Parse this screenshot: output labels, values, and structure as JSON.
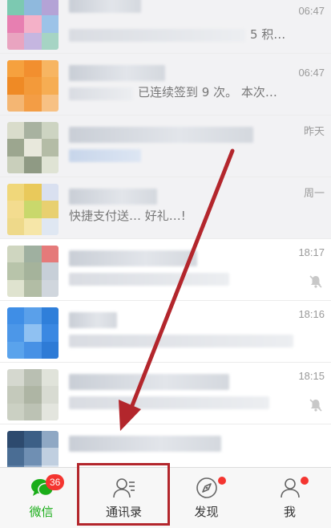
{
  "chats": [
    {
      "time": "06:47",
      "message": "5 积…"
    },
    {
      "time": "06:47",
      "message": "已连续签到 9 次。 本次…"
    },
    {
      "time": "昨天",
      "message": ""
    },
    {
      "time": "周一",
      "message": "快捷支付送… 好礼…!"
    },
    {
      "time": "18:17",
      "message": ""
    },
    {
      "time": "18:16",
      "message": ""
    },
    {
      "time": "18:15",
      "message": ""
    },
    {
      "time": "",
      "message": ""
    }
  ],
  "tabs": [
    {
      "label": "微信",
      "badge": "36",
      "icon": "chat-bubble-icon",
      "active": true
    },
    {
      "label": "通讯录",
      "icon": "contacts-icon",
      "active": false
    },
    {
      "label": "发现",
      "icon": "compass-icon",
      "active": false,
      "dot": true
    },
    {
      "label": "我",
      "icon": "person-icon",
      "active": false,
      "dot": true
    }
  ],
  "colors": {
    "accent_green": "#1aad19",
    "badge_red": "#f43530",
    "annotation_red": "#b3262c"
  }
}
